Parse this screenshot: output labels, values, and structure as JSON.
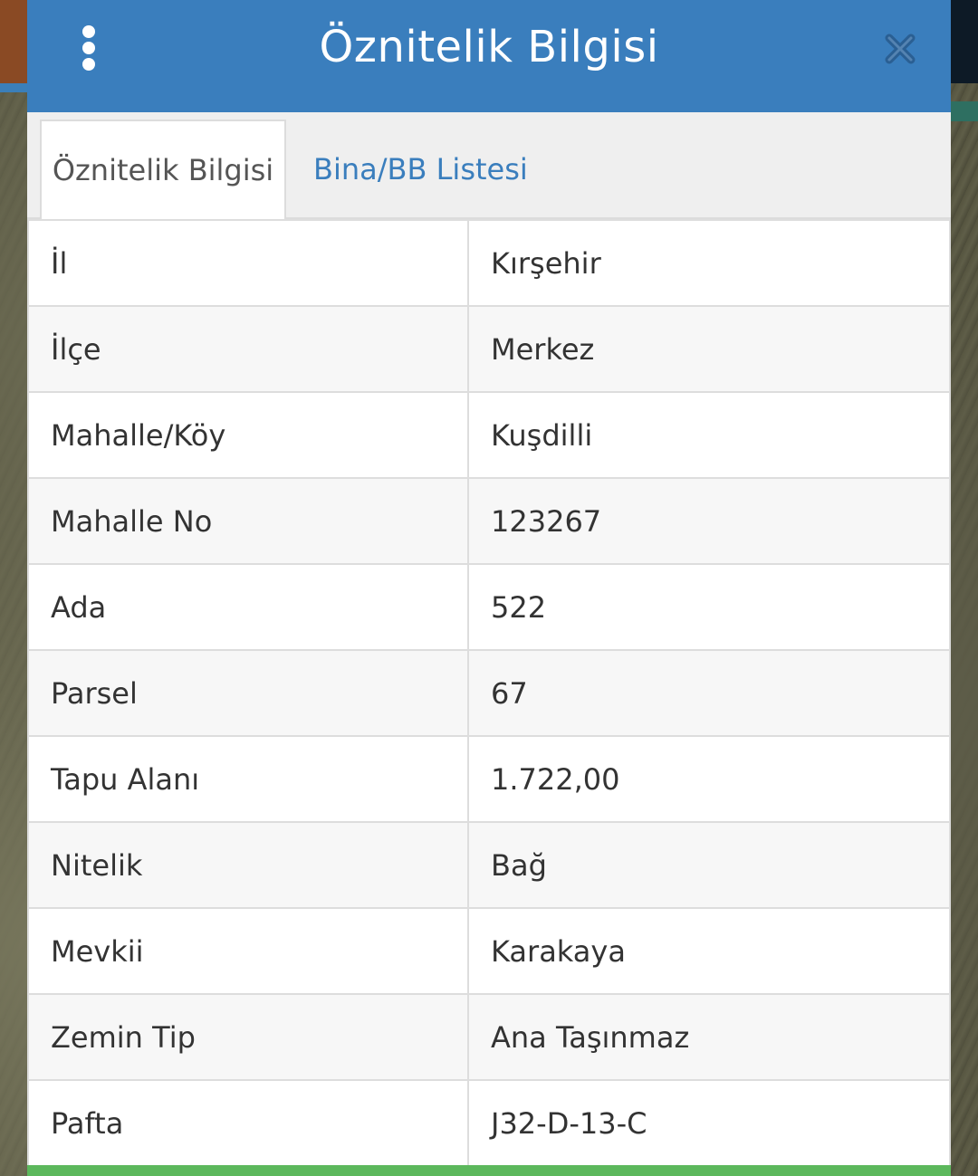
{
  "dialog": {
    "title": "Öznitelik Bilgisi",
    "menu_icon": "vertical-ellipsis-icon",
    "close_icon": "close-icon"
  },
  "tabs": [
    {
      "label": "Öznitelik Bilgisi",
      "active": true
    },
    {
      "label": "Bina/BB Listesi",
      "active": false
    }
  ],
  "rows": [
    {
      "key": "İl",
      "value": "Kırşehir"
    },
    {
      "key": "İlçe",
      "value": "Merkez"
    },
    {
      "key": "Mahalle/Köy",
      "value": "Kuşdilli"
    },
    {
      "key": "Mahalle No",
      "value": "123267"
    },
    {
      "key": "Ada",
      "value": "522"
    },
    {
      "key": "Parsel",
      "value": "67"
    },
    {
      "key": "Tapu Alanı",
      "value": "1.722,00"
    },
    {
      "key": "Nitelik",
      "value": "Bağ"
    },
    {
      "key": "Mevkii",
      "value": "Karakaya"
    },
    {
      "key": "Zemin Tip",
      "value": "Ana Taşınmaz"
    },
    {
      "key": "Pafta",
      "value": "J32-D-13-C"
    }
  ],
  "colors": {
    "titlebar": "#3a7ebd",
    "accent_link": "#3a7ebd",
    "bottom_bar": "#5cb85c"
  }
}
